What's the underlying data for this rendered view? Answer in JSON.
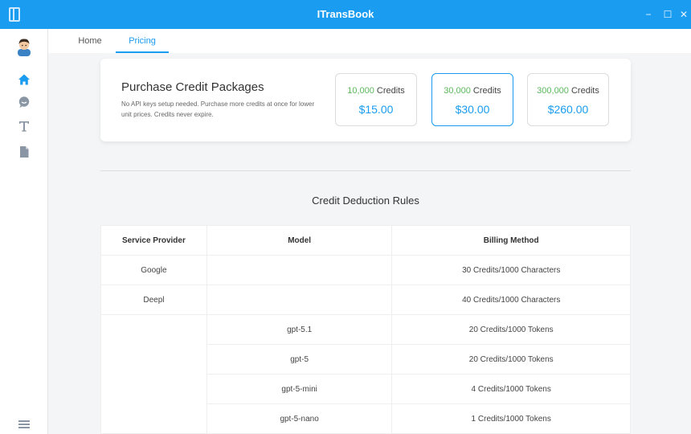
{
  "window": {
    "title": "ITransBook",
    "minimize_glyph": "−",
    "maximize_glyph": "☐",
    "close_glyph": "✕"
  },
  "sidebar": {
    "items": [
      {
        "name": "home",
        "icon": "home-icon",
        "active": true
      },
      {
        "name": "chat",
        "icon": "chat-icon"
      },
      {
        "name": "text",
        "icon": "text-icon"
      },
      {
        "name": "document",
        "icon": "document-icon"
      }
    ],
    "bottom_icon": "menu-icon"
  },
  "tabs": [
    {
      "label": "Home",
      "active": false
    },
    {
      "label": "Pricing",
      "active": true
    }
  ],
  "packages": {
    "title": "Purchase Credit Packages",
    "description": "No API keys setup needed. Purchase more credits at once for lower unit prices. Credits never expire.",
    "credits_suffix": " Credits",
    "items": [
      {
        "amount": "10,000",
        "price": "$15.00",
        "selected": false
      },
      {
        "amount": "30,000",
        "price": "$30.00",
        "selected": true
      },
      {
        "amount": "300,000",
        "price": "$260.00",
        "selected": false
      }
    ]
  },
  "rules": {
    "title": "Credit Deduction Rules",
    "headers": [
      "Service Provider",
      "Model",
      "Billing Method"
    ],
    "rows": [
      {
        "provider": "Google",
        "model": "",
        "billing": "30 Credits/1000 Characters"
      },
      {
        "provider": "Deepl",
        "model": "",
        "billing": "40 Credits/1000 Characters"
      },
      {
        "provider": "",
        "model": "gpt-5.1",
        "billing": "20 Credits/1000 Tokens"
      },
      {
        "provider": "",
        "model": "gpt-5",
        "billing": "20 Credits/1000 Tokens"
      },
      {
        "provider": "",
        "model": "gpt-5-mini",
        "billing": "4 Credits/1000 Tokens"
      },
      {
        "provider": "",
        "model": "gpt-5-nano",
        "billing": "1 Credits/1000 Tokens"
      }
    ]
  },
  "colors": {
    "accent": "#1a9cf0",
    "credit_number": "#5cb85c"
  }
}
